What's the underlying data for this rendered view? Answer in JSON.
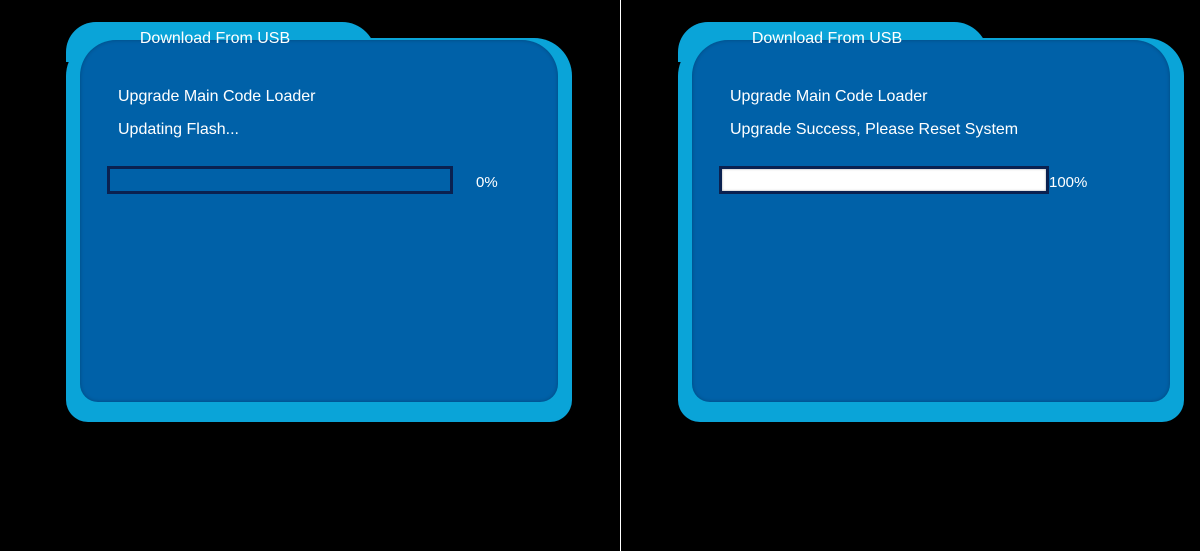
{
  "screens": [
    {
      "title": "Download From USB",
      "line1": "Upgrade Main Code Loader",
      "line2": "Updating Flash...",
      "progress_label": "0%",
      "progress_fraction": 0.0
    },
    {
      "title": "Download From USB",
      "line1": "Upgrade Main Code Loader",
      "line2": "Upgrade Success, Please Reset System",
      "progress_label": "100%",
      "progress_fraction": 1.0
    }
  ],
  "colors": {
    "frame": "#0aa4d8",
    "panel": "#0061a8",
    "bar_border": "#0a2150",
    "bar_fill": "#ffffff",
    "text": "#ffffff",
    "background": "#000000"
  }
}
